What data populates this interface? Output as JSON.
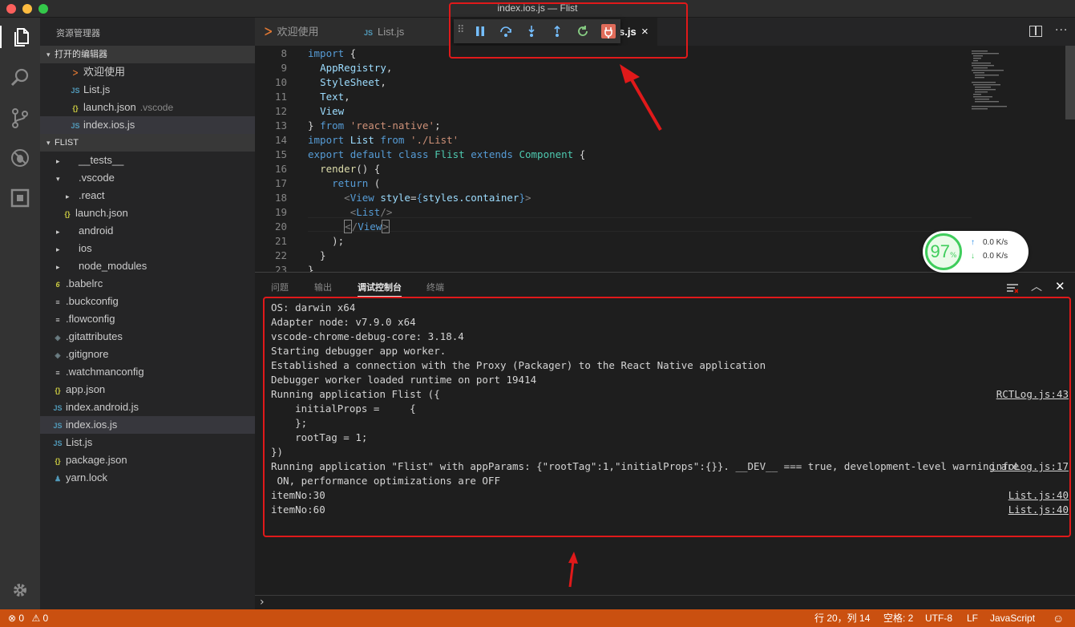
{
  "window": {
    "title": "index.ios.js — Flist"
  },
  "sidebar": {
    "title": "资源管理器",
    "open_editors_header": "打开的编辑器",
    "open_editors": [
      {
        "icon": "vscode-icon",
        "name": "欢迎使用",
        "desc": ""
      },
      {
        "icon": "js-file-icon",
        "name": "List.js",
        "desc": ""
      },
      {
        "icon": "json-file-icon",
        "name": "launch.json",
        "desc": ".vscode"
      },
      {
        "icon": "js-file-icon",
        "name": "index.ios.js",
        "desc": ""
      }
    ],
    "project_header": "FLIST",
    "tree": [
      {
        "name": "__tests__",
        "icon": "folder",
        "open": false
      },
      {
        "name": ".vscode",
        "icon": "folder",
        "open": true
      },
      {
        "name": ".react",
        "icon": "folder",
        "open": false
      },
      {
        "name": "launch.json",
        "icon": "json"
      },
      {
        "name": "android",
        "icon": "folder",
        "open": false
      },
      {
        "name": "ios",
        "icon": "folder",
        "open": false
      },
      {
        "name": "node_modules",
        "icon": "folder",
        "open": false
      },
      {
        "name": ".babelrc",
        "icon": "babel"
      },
      {
        "name": ".buckconfig",
        "icon": "config"
      },
      {
        "name": ".flowconfig",
        "icon": "config"
      },
      {
        "name": ".gitattributes",
        "icon": "git"
      },
      {
        "name": ".gitignore",
        "icon": "git"
      },
      {
        "name": ".watchmanconfig",
        "icon": "config"
      },
      {
        "name": "app.json",
        "icon": "json"
      },
      {
        "name": "index.android.js",
        "icon": "js"
      },
      {
        "name": "index.ios.js",
        "icon": "js"
      },
      {
        "name": "List.js",
        "icon": "js"
      },
      {
        "name": "package.json",
        "icon": "json"
      },
      {
        "name": "yarn.lock",
        "icon": "yarn"
      }
    ]
  },
  "tabs": [
    {
      "label": "欢迎使用",
      "icon": "vscode-icon"
    },
    {
      "label": "List.js",
      "icon": "JS"
    },
    {
      "label": "index.ios.js",
      "icon": "JS",
      "visible_suffix": "s.js",
      "close": "×"
    }
  ],
  "editor": {
    "line_numbers": [
      "8",
      "9",
      "10",
      "11",
      "12",
      "13",
      "14",
      "15",
      "16",
      "17",
      "18",
      "19",
      "20",
      "21",
      "22",
      "23"
    ]
  },
  "panel": {
    "tabs": [
      "问题",
      "输出",
      "调试控制台",
      "终端"
    ],
    "active_tab": "调试控制台",
    "lines": [
      {
        "text": "OS: darwin x64",
        "src": ""
      },
      {
        "text": "Adapter node: v7.9.0 x64",
        "src": ""
      },
      {
        "text": "vscode-chrome-debug-core: 3.18.4",
        "src": ""
      },
      {
        "text": "Starting debugger app worker.",
        "src": ""
      },
      {
        "text": "Established a connection with the Proxy (Packager) to the React Native application",
        "src": ""
      },
      {
        "text": "Debugger worker loaded runtime on port 19414",
        "src": ""
      },
      {
        "text": "Running application Flist ({",
        "src": "RCTLog.js:43"
      },
      {
        "text": "    initialProps =     {",
        "src": ""
      },
      {
        "text": "    };",
        "src": ""
      },
      {
        "text": "    rootTag = 1;",
        "src": ""
      },
      {
        "text": "})",
        "src": ""
      },
      {
        "text": "Running application \"Flist\" with appParams: {\"rootTag\":1,\"initialProps\":{}}. __DEV__ === true, development-level warning are",
        "src": "infoLog.js:17"
      },
      {
        "text": " ON, performance optimizations are OFF",
        "src": ""
      },
      {
        "text": "itemNo:30",
        "src": "List.js:40"
      },
      {
        "text": "itemNo:60",
        "src": "List.js:40"
      }
    ],
    "prompt": "›"
  },
  "net_widget": {
    "cpu": "97",
    "cpu_unit": "%",
    "upload": "0.0 K/s",
    "download": "0.0 K/s"
  },
  "status": {
    "errors": "0",
    "warnings": "0",
    "position": "行 20，列 14",
    "spaces": "空格: 2",
    "encoding": "UTF-8",
    "eol": "LF",
    "language": "JavaScript",
    "feedback_icon": "☺"
  },
  "colors": {
    "status_bar": "#ca5010",
    "annotation": "#e0191a",
    "sidebar": "#252526",
    "editor": "#1e1e1e"
  }
}
